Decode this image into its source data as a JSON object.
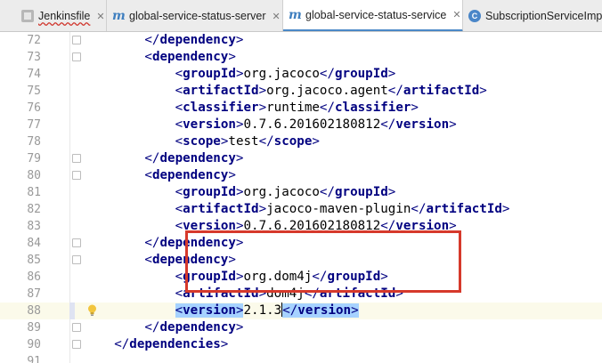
{
  "tabs": [
    {
      "label": "Jenkinsfile",
      "icon": "jenkins-file-icon",
      "active": false,
      "has_close": true
    },
    {
      "label": "global-service-status-server",
      "icon": "maven-m-icon",
      "active": false,
      "has_close": true
    },
    {
      "label": "global-service-status-service",
      "icon": "maven-m-icon",
      "active": true,
      "has_close": true
    },
    {
      "label": "SubscriptionServiceImpl.",
      "icon": "java-class-c-icon",
      "active": false,
      "has_close": false
    }
  ],
  "close_glyph": "✕",
  "editor": {
    "current_line": 88,
    "lines": [
      {
        "n": "72",
        "indent": 8,
        "parts": [
          [
            "br",
            "</"
          ],
          [
            "tag",
            "dependency"
          ],
          [
            "br",
            ">"
          ]
        ]
      },
      {
        "n": "73",
        "indent": 8,
        "parts": [
          [
            "br",
            "<"
          ],
          [
            "tag",
            "dependency"
          ],
          [
            "br",
            ">"
          ]
        ]
      },
      {
        "n": "74",
        "indent": 12,
        "parts": [
          [
            "br",
            "<"
          ],
          [
            "tag",
            "groupId"
          ],
          [
            "br",
            ">"
          ],
          [
            "txt",
            "org.jacoco"
          ],
          [
            "br",
            "</"
          ],
          [
            "tag",
            "groupId"
          ],
          [
            "br",
            ">"
          ]
        ]
      },
      {
        "n": "75",
        "indent": 12,
        "parts": [
          [
            "br",
            "<"
          ],
          [
            "tag",
            "artifactId"
          ],
          [
            "br",
            ">"
          ],
          [
            "txt",
            "org.jacoco.agent"
          ],
          [
            "br",
            "</"
          ],
          [
            "tag",
            "artifactId"
          ],
          [
            "br",
            ">"
          ]
        ]
      },
      {
        "n": "76",
        "indent": 12,
        "parts": [
          [
            "br",
            "<"
          ],
          [
            "tag",
            "classifier"
          ],
          [
            "br",
            ">"
          ],
          [
            "txt",
            "runtime"
          ],
          [
            "br",
            "</"
          ],
          [
            "tag",
            "classifier"
          ],
          [
            "br",
            ">"
          ]
        ]
      },
      {
        "n": "77",
        "indent": 12,
        "parts": [
          [
            "br",
            "<"
          ],
          [
            "tag",
            "version"
          ],
          [
            "br",
            ">"
          ],
          [
            "txt",
            "0.7.6.201602180812"
          ],
          [
            "br",
            "</"
          ],
          [
            "tag",
            "version"
          ],
          [
            "br",
            ">"
          ]
        ]
      },
      {
        "n": "78",
        "indent": 12,
        "parts": [
          [
            "br",
            "<"
          ],
          [
            "tag",
            "scope"
          ],
          [
            "br",
            ">"
          ],
          [
            "txt",
            "test"
          ],
          [
            "br",
            "</"
          ],
          [
            "tag",
            "scope"
          ],
          [
            "br",
            ">"
          ]
        ]
      },
      {
        "n": "79",
        "indent": 8,
        "parts": [
          [
            "br",
            "</"
          ],
          [
            "tag",
            "dependency"
          ],
          [
            "br",
            ">"
          ]
        ]
      },
      {
        "n": "80",
        "indent": 8,
        "parts": [
          [
            "br",
            "<"
          ],
          [
            "tag",
            "dependency"
          ],
          [
            "br",
            ">"
          ]
        ]
      },
      {
        "n": "81",
        "indent": 12,
        "parts": [
          [
            "br",
            "<"
          ],
          [
            "tag",
            "groupId"
          ],
          [
            "br",
            ">"
          ],
          [
            "txt",
            "org.jacoco"
          ],
          [
            "br",
            "</"
          ],
          [
            "tag",
            "groupId"
          ],
          [
            "br",
            ">"
          ]
        ]
      },
      {
        "n": "82",
        "indent": 12,
        "parts": [
          [
            "br",
            "<"
          ],
          [
            "tag",
            "artifactId"
          ],
          [
            "br",
            ">"
          ],
          [
            "txt",
            "jacoco-maven-plugin"
          ],
          [
            "br",
            "</"
          ],
          [
            "tag",
            "artifactId"
          ],
          [
            "br",
            ">"
          ]
        ]
      },
      {
        "n": "83",
        "indent": 12,
        "parts": [
          [
            "br",
            "<"
          ],
          [
            "tag",
            "version"
          ],
          [
            "br",
            ">"
          ],
          [
            "txt",
            "0.7.6.201602180812"
          ],
          [
            "br",
            "</"
          ],
          [
            "tag",
            "version"
          ],
          [
            "br",
            ">"
          ]
        ]
      },
      {
        "n": "84",
        "indent": 8,
        "parts": [
          [
            "br",
            "</"
          ],
          [
            "tag",
            "dependency"
          ],
          [
            "br",
            ">"
          ]
        ]
      },
      {
        "n": "85",
        "indent": 8,
        "parts": [
          [
            "br",
            "<"
          ],
          [
            "tag",
            "dependency"
          ],
          [
            "br",
            ">"
          ]
        ]
      },
      {
        "n": "86",
        "indent": 12,
        "parts": [
          [
            "br",
            "<"
          ],
          [
            "tag",
            "groupId"
          ],
          [
            "br",
            ">"
          ],
          [
            "txt",
            "org.dom4j"
          ],
          [
            "br",
            "</"
          ],
          [
            "tag",
            "groupId"
          ],
          [
            "br",
            ">"
          ]
        ]
      },
      {
        "n": "87",
        "indent": 12,
        "parts": [
          [
            "br",
            "<"
          ],
          [
            "tag",
            "artifactId"
          ],
          [
            "br",
            ">"
          ],
          [
            "txt",
            "dom4j"
          ],
          [
            "br",
            "</"
          ],
          [
            "tag",
            "artifactId"
          ],
          [
            "br",
            ">"
          ]
        ]
      },
      {
        "n": "88",
        "indent": 12,
        "parts": [
          [
            "sbr",
            "<"
          ],
          [
            "stag",
            "version"
          ],
          [
            "sbr",
            ">"
          ],
          [
            "txt",
            "2.1.3"
          ],
          [
            "caret",
            ""
          ],
          [
            "sbr",
            "</"
          ],
          [
            "stag",
            "version"
          ],
          [
            "sbr",
            ">"
          ]
        ]
      },
      {
        "n": "89",
        "indent": 8,
        "parts": [
          [
            "br",
            "</"
          ],
          [
            "tag",
            "dependency"
          ],
          [
            "br",
            ">"
          ]
        ]
      },
      {
        "n": "90",
        "indent": 4,
        "parts": [
          [
            "br",
            "</"
          ],
          [
            "tag",
            "dependencies"
          ],
          [
            "br",
            ">"
          ]
        ]
      },
      {
        "n": "91",
        "indent": 0,
        "parts": []
      }
    ]
  }
}
